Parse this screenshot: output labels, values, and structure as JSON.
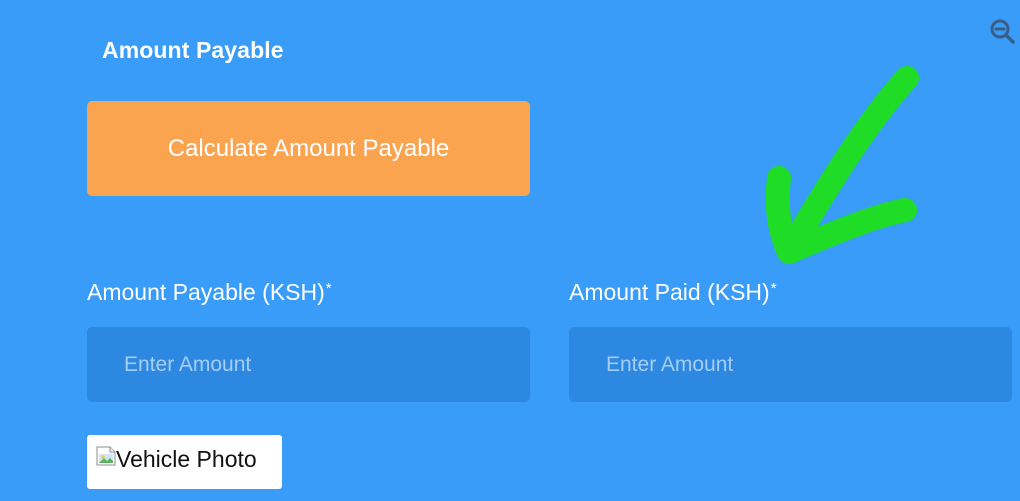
{
  "section": {
    "title": "Amount Payable"
  },
  "calculate_button": {
    "label": "Calculate Amount Payable",
    "color": "#fba450"
  },
  "fields": {
    "amount_payable": {
      "label": "Amount Payable (KSH)",
      "required_marker": "*",
      "placeholder": "Enter Amount",
      "value": ""
    },
    "amount_paid": {
      "label": "Amount Paid (KSH)",
      "required_marker": "*",
      "placeholder": "Enter Amount",
      "value": ""
    }
  },
  "vehicle_photo": {
    "alt_text": "Vehicle Photo",
    "icon": "broken-image-icon"
  },
  "toolbar": {
    "zoom_out_icon": "zoom-out-icon"
  },
  "annotation": {
    "icon": "green-arrow",
    "color": "#1fdc26"
  },
  "theme": {
    "background": "#399cf9",
    "input_background": "#2d88e2",
    "text": "#ffffff"
  }
}
